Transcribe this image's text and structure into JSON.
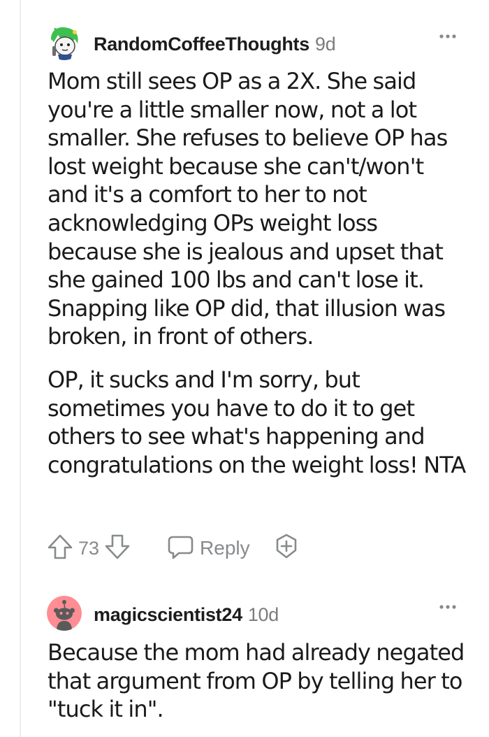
{
  "comments": [
    {
      "username": "RandomCoffeeThoughts",
      "age": "9d",
      "avatar": "green-hair-avatar-icon",
      "paragraphs": [
        "Mom still sees OP as a 2X. She said you're a little smaller now, not a lot smaller. She refuses to believe OP has lost weight because she can't/won't and it's a comfort to her to not acknowledging OPs weight loss because she is jealous and upset that she gained 100 lbs and can't lose it. Snapping like OP did, that illusion was broken, in front of others.",
        "OP, it sucks and I'm sorry, but sometimes you have to do it to get others to see what's happening and congratulations on the weight loss! NTA"
      ],
      "score": "73",
      "reply_label": "Reply"
    },
    {
      "username": "magicscientist24",
      "age": "10d",
      "avatar": "snoo-avatar-icon",
      "paragraphs": [
        "Because the mom had already negated that argument from OP by telling her to \"tuck it in\"."
      ]
    }
  ],
  "colors": {
    "text": "#1a1a1b",
    "meta": "#7c7c7c",
    "icon": "#878a8c",
    "thread_line": "#edeff1",
    "snoo_bg": "#ff8d93"
  }
}
